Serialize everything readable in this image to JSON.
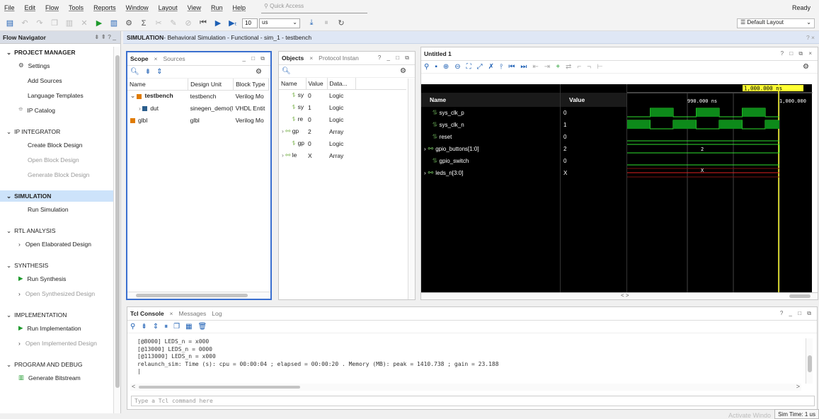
{
  "menu": {
    "items": [
      "File",
      "Edit",
      "Flow",
      "Tools",
      "Reports",
      "Window",
      "Layout",
      "View",
      "Run",
      "Help"
    ],
    "quick_access_placeholder": "Quick Access",
    "status": "Ready"
  },
  "toolbar": {
    "run_time_value": "10",
    "run_time_unit": "us",
    "layout": "Default Layout"
  },
  "flow_navigator": {
    "title": "Flow Navigator",
    "sections": [
      {
        "label": "PROJECT MANAGER",
        "items": [
          {
            "label": "Settings",
            "icon": "gear-icon"
          },
          {
            "label": "Add Sources"
          },
          {
            "label": "Language Templates"
          },
          {
            "label": "IP Catalog",
            "icon": "ip-catalog-icon"
          }
        ]
      },
      {
        "label": "IP INTEGRATOR",
        "items": [
          {
            "label": "Create Block Design"
          },
          {
            "label": "Open Block Design",
            "disabled": true
          },
          {
            "label": "Generate Block Design",
            "disabled": true
          }
        ]
      },
      {
        "label": "SIMULATION",
        "selected": true,
        "items": [
          {
            "label": "Run Simulation"
          }
        ]
      },
      {
        "label": "RTL ANALYSIS",
        "items": [
          {
            "label": "Open Elaborated Design",
            "expander": true
          }
        ]
      },
      {
        "label": "SYNTHESIS",
        "items": [
          {
            "label": "Run Synthesis",
            "icon": "play-icon"
          },
          {
            "label": "Open Synthesized Design",
            "expander": true,
            "disabled": true
          }
        ]
      },
      {
        "label": "IMPLEMENTATION",
        "items": [
          {
            "label": "Run Implementation",
            "icon": "play-icon"
          },
          {
            "label": "Open Implemented Design",
            "expander": true,
            "disabled": true
          }
        ]
      },
      {
        "label": "PROGRAM AND DEBUG",
        "items": [
          {
            "label": "Generate Bitstream",
            "icon": "bitstream-icon"
          }
        ]
      }
    ]
  },
  "main_title": {
    "bold": "SIMULATION",
    "rest": " - Behavioral Simulation - Functional - sim_1 - testbench"
  },
  "scope": {
    "tab_active": "Scope",
    "tab_other": "Sources",
    "columns": [
      "Name",
      "Design Unit",
      "Block Type"
    ],
    "rows": [
      {
        "name": "testbench",
        "unit": "testbench",
        "type": "Verilog Mo",
        "level": 0,
        "bold": true,
        "color": "#e07b00"
      },
      {
        "name": "dut",
        "unit": "sinegen_demo(l",
        "type": "VHDL Entit",
        "level": 1,
        "color": "#2b5e8c"
      },
      {
        "name": "glbl",
        "unit": "glbl",
        "type": "Verilog Mo",
        "level": 0,
        "color": "#e07b00"
      }
    ]
  },
  "objects": {
    "tab_active": "Objects",
    "tab_other": "Protocol Instan",
    "columns": [
      "Name",
      "Value",
      "Data..."
    ],
    "rows": [
      {
        "name": "sy",
        "value": "0",
        "type": "Logic"
      },
      {
        "name": "sy",
        "value": "1",
        "type": "Logic"
      },
      {
        "name": "re",
        "value": "0",
        "type": "Logic"
      },
      {
        "name": "gp",
        "value": "2",
        "type": "Array",
        "exp": true
      },
      {
        "name": "gp",
        "value": "0",
        "type": "Logic"
      },
      {
        "name": "le",
        "value": "X",
        "type": "Array",
        "exp": true
      }
    ]
  },
  "wave": {
    "title": "Untitled 1",
    "col_name": "Name",
    "col_value": "Value",
    "cursor_label": "1,000.000 ns",
    "time_mid": "990.000 ns",
    "time_right": "1,000.000",
    "signals": [
      {
        "name": "sys_clk_p",
        "value": "0"
      },
      {
        "name": "sys_clk_n",
        "value": "1"
      },
      {
        "name": "reset",
        "value": "0"
      },
      {
        "name": "gpio_buttons[1:0]",
        "value": "2",
        "bus": true
      },
      {
        "name": "gpio_switch",
        "value": "0"
      },
      {
        "name": "leds_n[3:0]",
        "value": "X",
        "bus": true
      }
    ],
    "bus_labels": [
      "2",
      "X"
    ]
  },
  "console": {
    "tab_active": "Tcl Console",
    "tab_messages": "Messages",
    "tab_log": "Log",
    "lines": [
      "[@8000] LEDS_n = x000",
      "[@13000] LEDS_n = 0000",
      "[@113000] LEDS_n = x000",
      "relaunch_sim: Time (s): cpu = 00:00:04 ; elapsed = 00:00:20 . Memory (MB): peak = 1410.738 ; gain = 23.188"
    ],
    "input_placeholder": "Type a Tcl command here"
  },
  "status": {
    "sim_time": "Sim Time: 1 us",
    "watermark": "Activate Windo"
  }
}
